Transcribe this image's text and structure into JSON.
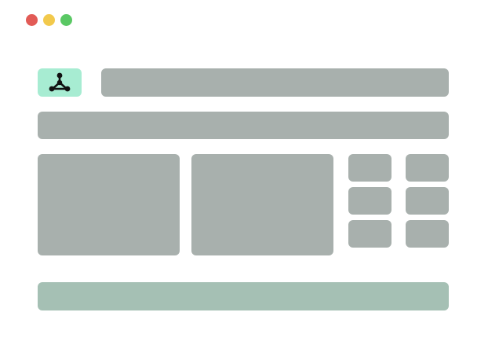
{
  "window": {
    "controls": [
      {
        "name": "close",
        "color": "#e25b56"
      },
      {
        "name": "minimize",
        "color": "#f2c94c"
      },
      {
        "name": "maximize",
        "color": "#5ac864"
      }
    ]
  },
  "header": {
    "logo": {
      "icon": "network-nodes-icon",
      "background": "#a7ecd2",
      "glyph_color": "#111111"
    }
  },
  "colors": {
    "placeholder": "#a8b0ad",
    "accent_bar": "#a5c0b4",
    "background": "#ffffff"
  }
}
